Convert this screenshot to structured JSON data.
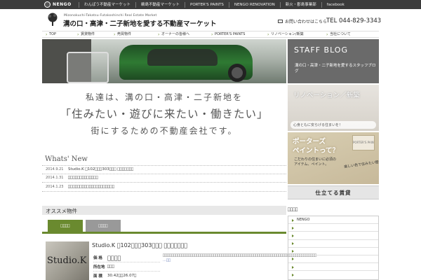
{
  "topbar": {
    "logo": "NENGO",
    "links": [
      "わんぱう不動産マーケット",
      "鵜島不動産マーケット",
      "PORTER'S PAINTS",
      "NENGO RENOVATION",
      "新火・郡島事業部",
      "facebook"
    ]
  },
  "header": {
    "subtitle": "Mizonokuchi-Takatsu-Futakoshinchi Real Estate Market",
    "title": "溝の口・高津・二子新地を愛する不動産マーケット",
    "contact_label": "お問い合わせはこちら",
    "tel": "TEL 044-829-3343"
  },
  "nav": [
    "TOP",
    "賃貸物件",
    "売買物件",
    "オーナーの皆様へ",
    "PORTER'S PAINTS",
    "リノベーション/新築",
    "当社について"
  ],
  "tagline": {
    "line1": "私達は、溝の口・高津・二子新地を",
    "line2": "「住みたい・遊びに来たい・働きたい」",
    "line3": "街にするための不動産会社です。"
  },
  "whats_new": {
    "title": "Whats' New",
    "items": [
      {
        "date": "2014.9.21",
        "text": "Studio.K 􀀀102􀀀􀀀􀀀303􀀀􀀀􀀀 􀀀􀀀􀀀􀀀􀀀􀀀􀀀"
      },
      {
        "date": "2014.1.31",
        "text": "􀀀􀀀􀀀􀀀􀀀􀀀􀀀􀀀􀀀􀀀􀀀􀀀􀀀"
      },
      {
        "date": "2014.1.23",
        "text": "􀀀􀀀􀀀􀀀􀀀􀀀􀀀􀀀􀀀􀀀􀀀􀀀􀀀􀀀􀀀􀀀􀀀􀀀􀀀􀀀"
      }
    ]
  },
  "recommend": {
    "title": "オススメ物件",
    "tab_active": "􀀀􀀀􀀀􀀀",
    "tab_inactive": "􀀀􀀀􀀀􀀀",
    "listing": {
      "photo_text": "Studio.K",
      "title": "Studio.K 􀀀102􀀀􀀀􀀀303􀀀􀀀􀀀 􀀀􀀀􀀀􀀀􀀀􀀀􀀀",
      "rows": [
        {
          "key": "価 格",
          "value": "􀀀􀀀􀀀􀀀"
        },
        {
          "key": "所在地",
          "value": "􀀀􀀀􀀀"
        },
        {
          "key": "面 積",
          "value": "30.42􀀀􀀀26.07􀀀"
        }
      ],
      "description": "􀀀􀀀􀀀􀀀􀀀􀀀􀀀􀀀􀀀􀀀􀀀􀀀􀀀􀀀􀀀􀀀􀀀􀀀􀀀􀀀􀀀􀀀􀀀􀀀􀀀􀀀􀀀􀀀􀀀􀀀􀀀􀀀􀀀􀀀􀀀􀀀􀀀􀀀􀀀􀀀􀀀􀀀􀀀􀀀􀀀􀀀􀀀􀀀􀀀􀀀􀀀􀀀􀀀􀀀􀀀􀀀􀀀􀀀􀀀􀀀􀀀􀀀􀀀􀀀􀀀􀀀􀀀􀀀􀀀􀀀􀀀􀀀􀀀",
      "more": "…􀀀􀀀"
    }
  },
  "sidebar": {
    "staff_blog": {
      "title": "STAFF BLOG",
      "sub": "溝の口・高津・二子新地を愛するスタッフブログ"
    },
    "renovation": {
      "title": "リノベーション／新築",
      "bar": "心身ともに安らげる住まいを！"
    },
    "paints": {
      "title1": "ポーターズ",
      "title2": "ペイントって？",
      "sub": "こだわりの住まいに必須のアイテム、ペイント。",
      "can": "PORTER'S PAINTS",
      "badge": "楽しい色で住みたい壁を"
    },
    "rental": "仕立てる賃貸",
    "pro": {
      "title": "􀀀􀀀􀀀􀀀",
      "items": [
        "NENGO",
        "",
        "",
        "",
        "",
        "",
        "",
        ""
      ]
    }
  },
  "colors": {
    "accent": "#6a8a2f",
    "topbar": "#3b3b3b"
  }
}
